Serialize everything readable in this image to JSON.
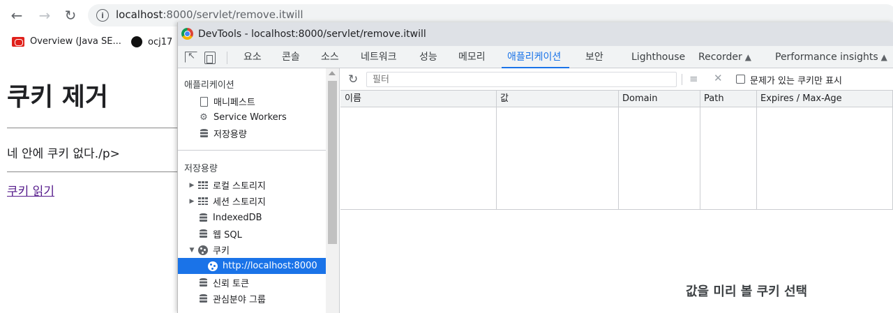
{
  "browser": {
    "url_host": "localhost",
    "url_rest": ":8000/servlet/remove.itwill",
    "bookmarks": [
      {
        "label": "Overview (Java SE..."
      },
      {
        "label": "ocj17"
      }
    ]
  },
  "page": {
    "heading": "쿠키 제거",
    "message": "네 안에 쿠키 없다./p>",
    "link": "쿠키 읽기"
  },
  "devtools": {
    "title": "DevTools - localhost:8000/servlet/remove.itwill",
    "tabs": [
      {
        "label": "요소"
      },
      {
        "label": "콘솔"
      },
      {
        "label": "소스"
      },
      {
        "label": "네트워크"
      },
      {
        "label": "성능"
      },
      {
        "label": "메모리"
      },
      {
        "label": "애플리케이션"
      },
      {
        "label": "보안"
      },
      {
        "label": "Lighthouse"
      },
      {
        "label": "Recorder"
      },
      {
        "label": "Performance insights"
      }
    ],
    "active_tab": "애플리케이션",
    "sidebar": {
      "section1": "애플리케이션",
      "app_items": [
        {
          "label": "매니페스트",
          "icon": "document-icon"
        },
        {
          "label": "Service Workers",
          "icon": "gear-icon"
        },
        {
          "label": "저장용량",
          "icon": "database-icon"
        }
      ],
      "section2": "저장용량",
      "storage_items": [
        {
          "label": "로컬 스토리지",
          "icon": "grid-icon"
        },
        {
          "label": "세션 스토리지",
          "icon": "grid-icon"
        },
        {
          "label": "IndexedDB",
          "icon": "database-icon"
        },
        {
          "label": "웹 SQL",
          "icon": "database-icon"
        },
        {
          "label": "쿠키",
          "icon": "cookie-icon"
        },
        {
          "label": "http://localhost:8000",
          "icon": "cookie-icon"
        },
        {
          "label": "신뢰 토큰",
          "icon": "database-icon"
        },
        {
          "label": "관심분야 그룹",
          "icon": "database-icon"
        }
      ]
    },
    "toolbar": {
      "filter_placeholder": "필터",
      "only_issues_label": "문제가 있는 쿠키만 표시"
    },
    "table": {
      "columns": [
        "이름",
        "값",
        "Domain",
        "Path",
        "Expires / Max-Age"
      ]
    },
    "preview_message": "값을 미리 볼 쿠키 선택"
  }
}
